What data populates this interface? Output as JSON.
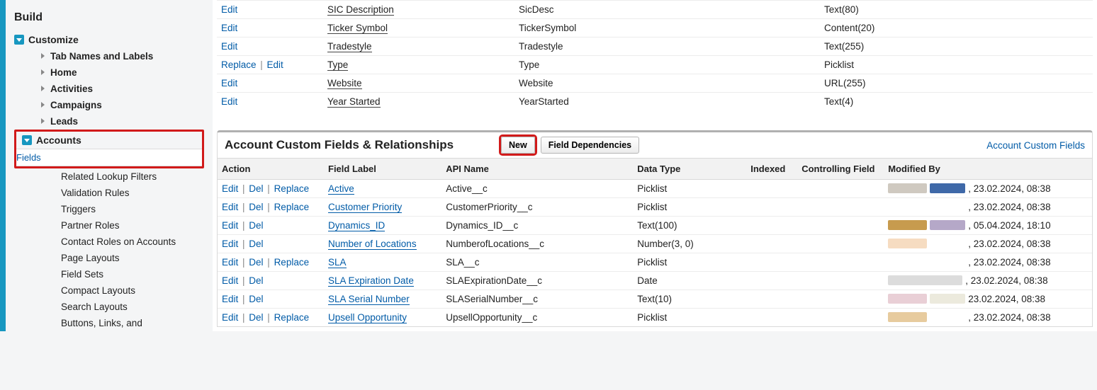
{
  "sidebar": {
    "section": "Build",
    "tree": [
      {
        "label": "Customize",
        "level": 0,
        "icon": "open"
      },
      {
        "label": "Tab Names and Labels",
        "level": 1,
        "icon": "closed"
      },
      {
        "label": "Home",
        "level": 1,
        "icon": "closed"
      },
      {
        "label": "Activities",
        "level": 1,
        "icon": "closed"
      },
      {
        "label": "Campaigns",
        "level": 1,
        "icon": "closed"
      },
      {
        "label": "Leads",
        "level": 1,
        "icon": "closed"
      }
    ],
    "accounts_label": "Accounts",
    "fields_label": "Fields",
    "accounts_children": [
      "Related Lookup Filters",
      "Validation Rules",
      "Triggers",
      "Partner Roles",
      "Contact Roles on Accounts",
      "Page Layouts",
      "Field Sets",
      "Compact Layouts",
      "Search Layouts",
      "Buttons, Links, and"
    ]
  },
  "top_rows": [
    {
      "actions": [
        "Edit"
      ],
      "label": "SIC Description",
      "api": "SicDesc",
      "type": "Text(80)"
    },
    {
      "actions": [
        "Edit"
      ],
      "label": "Ticker Symbol",
      "api": "TickerSymbol",
      "type": "Content(20)"
    },
    {
      "actions": [
        "Edit"
      ],
      "label": "Tradestyle",
      "api": "Tradestyle",
      "type": "Text(255)"
    },
    {
      "actions": [
        "Replace",
        "Edit"
      ],
      "label": "Type",
      "api": "Type",
      "type": "Picklist"
    },
    {
      "actions": [
        "Edit"
      ],
      "label": "Website",
      "api": "Website",
      "type": "URL(255)"
    },
    {
      "actions": [
        "Edit"
      ],
      "label": "Year Started",
      "api": "YearStarted",
      "type": "Text(4)"
    }
  ],
  "panel": {
    "title": "Account Custom Fields & Relationships",
    "btn_new": "New",
    "btn_deps": "Field Dependencies",
    "help_link": "Account Custom Fields"
  },
  "columns": {
    "action": "Action",
    "label": "Field Label",
    "api": "API Name",
    "type": "Data Type",
    "indexed": "Indexed",
    "controlling": "Controlling Field",
    "modified": "Modified By"
  },
  "rows": [
    {
      "actions": [
        "Edit",
        "Del",
        "Replace"
      ],
      "label": "Active",
      "api": "Active__c",
      "type": "Picklist",
      "mod": ", 23.02.2024, 08:38",
      "bars": [
        [
          "#cfc9c0",
          55
        ],
        [
          "#3f69a8",
          50
        ]
      ]
    },
    {
      "actions": [
        "Edit",
        "Del",
        "Replace"
      ],
      "label": "Customer Priority",
      "api": "CustomerPriority__c",
      "type": "Picklist",
      "mod": ", 23.02.2024, 08:38",
      "bars": [
        [
          "#ffffff",
          55
        ],
        [
          "#ffffff",
          50
        ]
      ]
    },
    {
      "actions": [
        "Edit",
        "Del"
      ],
      "label": "Dynamics_ID",
      "api": "Dynamics_ID__c",
      "type": "Text(100)",
      "mod": ", 05.04.2024, 18:10",
      "bars": [
        [
          "#c79b4e",
          55
        ],
        [
          "#b5a8c8",
          50
        ]
      ]
    },
    {
      "actions": [
        "Edit",
        "Del"
      ],
      "label": "Number of Locations",
      "api": "NumberofLocations__c",
      "type": "Number(3, 0)",
      "mod": ", 23.02.2024, 08:38",
      "bars": [
        [
          "#f6dcc1",
          55
        ],
        [
          "#ffffff",
          50
        ]
      ]
    },
    {
      "actions": [
        "Edit",
        "Del",
        "Replace"
      ],
      "label": "SLA",
      "api": "SLA__c",
      "type": "Picklist",
      "mod": ", 23.02.2024, 08:38",
      "bars": [
        [
          "#ffffff",
          55
        ],
        [
          "#ffffff",
          50
        ]
      ]
    },
    {
      "actions": [
        "Edit",
        "Del"
      ],
      "label": "SLA Expiration Date",
      "api": "SLAExpirationDate__c",
      "type": "Date",
      "mod": ", 23.02.2024, 08:38",
      "bars": [
        [
          "#dcdcdc",
          105
        ]
      ]
    },
    {
      "actions": [
        "Edit",
        "Del"
      ],
      "label": "SLA Serial Number",
      "api": "SLASerialNumber__c",
      "type": "Text(10)",
      "mod": "23.02.2024, 08:38",
      "bars": [
        [
          "#e9cfd6",
          55
        ],
        [
          "#eceadd",
          50
        ]
      ]
    },
    {
      "actions": [
        "Edit",
        "Del",
        "Replace"
      ],
      "label": "Upsell Opportunity",
      "api": "UpsellOpportunity__c",
      "type": "Picklist",
      "mod": ", 23.02.2024, 08:38",
      "bars": [
        [
          "#e7cb9e",
          55
        ],
        [
          "#ffffff",
          50
        ]
      ]
    }
  ]
}
